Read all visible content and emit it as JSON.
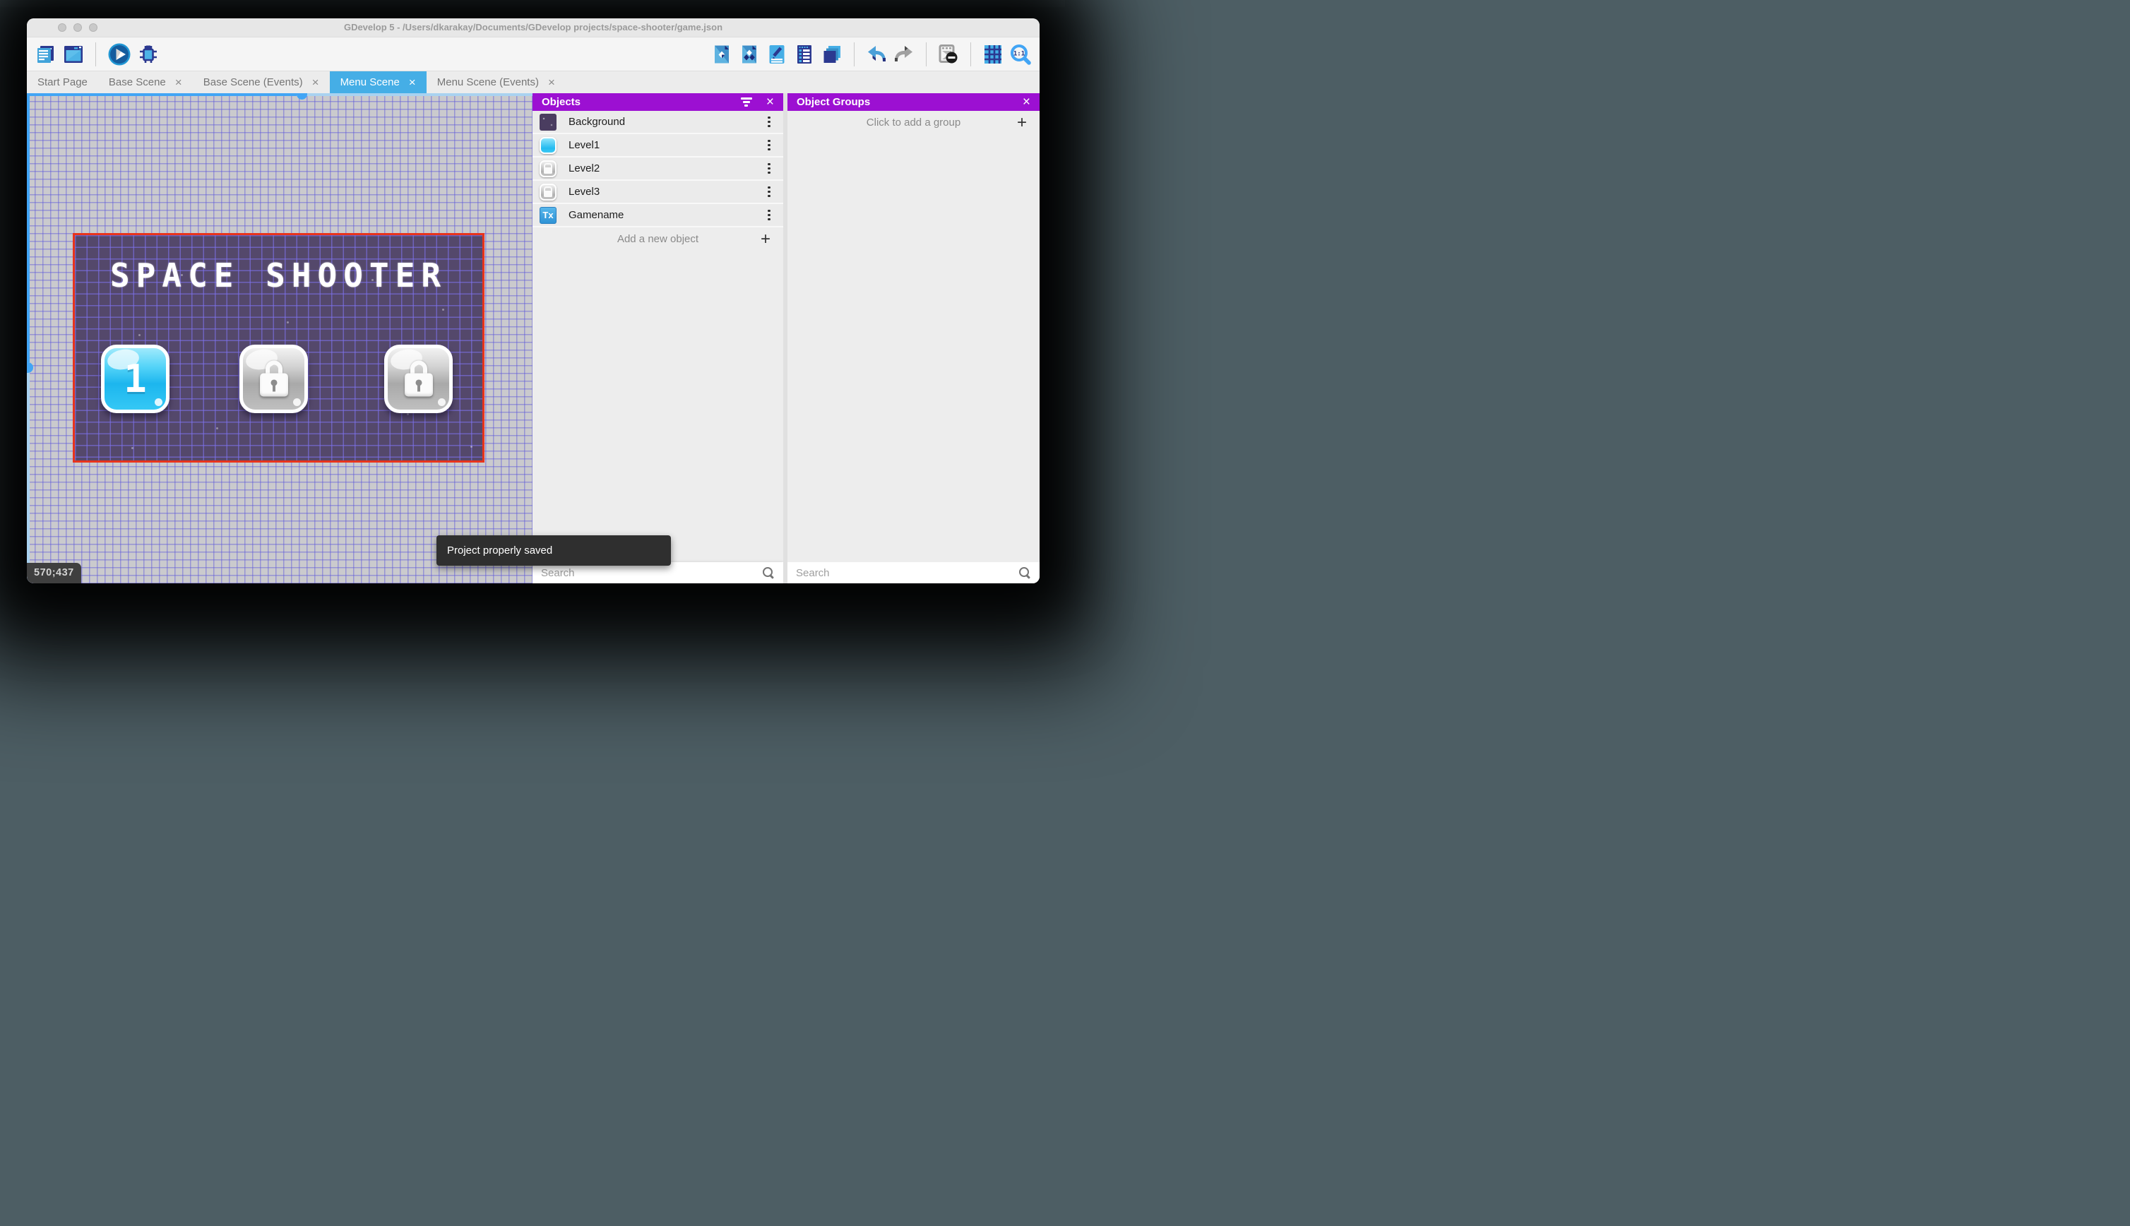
{
  "window": {
    "title": "GDevelop 5 - /Users/dkarakay/Documents/GDevelop projects/space-shooter/game.json",
    "traffic_lights": [
      "close",
      "minimize",
      "zoom"
    ]
  },
  "toolbar": {
    "left_icons": [
      "project-manager",
      "scene-window",
      "play-preview",
      "debug"
    ],
    "right_icons": [
      "add-object",
      "object-groups",
      "properties",
      "instances-list",
      "layers",
      "undo",
      "redo",
      "mask-preview",
      "grid",
      "zoom-1-1"
    ]
  },
  "tabs": [
    {
      "label": "Start Page",
      "active": false,
      "closable": false
    },
    {
      "label": "Base Scene",
      "active": false,
      "closable": true
    },
    {
      "label": "Base Scene (Events)",
      "active": false,
      "closable": true
    },
    {
      "label": "Menu Scene",
      "active": true,
      "closable": true
    },
    {
      "label": "Menu Scene (Events)",
      "active": false,
      "closable": true
    }
  ],
  "canvas": {
    "coordinates": "570;437"
  },
  "scene": {
    "title": "SPACE SHOOTER",
    "background_color": "#54486b",
    "selection_color": "#e8341c",
    "buttons": [
      {
        "id": "level1",
        "label": "1",
        "locked": false
      },
      {
        "id": "level2",
        "label": "",
        "locked": true
      },
      {
        "id": "level3",
        "label": "",
        "locked": true
      }
    ]
  },
  "objects_panel": {
    "title": "Objects",
    "items": [
      {
        "name": "Background",
        "thumb": "purple-grid-sprite"
      },
      {
        "name": "Level1",
        "thumb": "blue-button-sprite"
      },
      {
        "name": "Level2",
        "thumb": "locked-button-sprite"
      },
      {
        "name": "Level3",
        "thumb": "locked-button-sprite"
      },
      {
        "name": "Gamename",
        "thumb": "text-object"
      }
    ],
    "add_label": "Add a new object",
    "search_placeholder": "Search"
  },
  "object_groups_panel": {
    "title": "Object Groups",
    "add_label": "Click to add a group",
    "search_placeholder": "Search"
  },
  "toast": {
    "message": "Project properly saved"
  },
  "colors": {
    "panel_header": "#9c10d2",
    "active_tab": "#45aee6",
    "selection": "#e8341c",
    "toast_bg": "#2f2f2f",
    "scrollbar": "#42a5f5"
  }
}
